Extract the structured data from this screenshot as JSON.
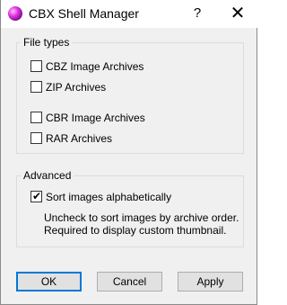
{
  "window": {
    "title": "CBX Shell Manager",
    "help_label": "?",
    "close_label": "✕"
  },
  "file_types": {
    "legend": "File types",
    "items": [
      {
        "label": "CBZ Image Archives",
        "checked": false
      },
      {
        "label": "ZIP Archives",
        "checked": false
      },
      {
        "label": "CBR Image Archives",
        "checked": false
      },
      {
        "label": "RAR Archives",
        "checked": false
      }
    ]
  },
  "advanced": {
    "legend": "Advanced",
    "sort_label": "Sort images alphabetically",
    "sort_checked": true,
    "tick_glyph": "✔",
    "note_line1": "Uncheck to sort images by archive order.",
    "note_line2": "Required to display custom thumbnail."
  },
  "buttons": {
    "ok": "OK",
    "cancel": "Cancel",
    "apply": "Apply"
  },
  "colors": {
    "accent": "#0078d7",
    "dialog_bg": "#f0f0f0",
    "icon": "#c21fc9"
  },
  "icons": {
    "app": "cbx-shell-manager-icon",
    "help": "help-icon",
    "close": "close-icon"
  }
}
